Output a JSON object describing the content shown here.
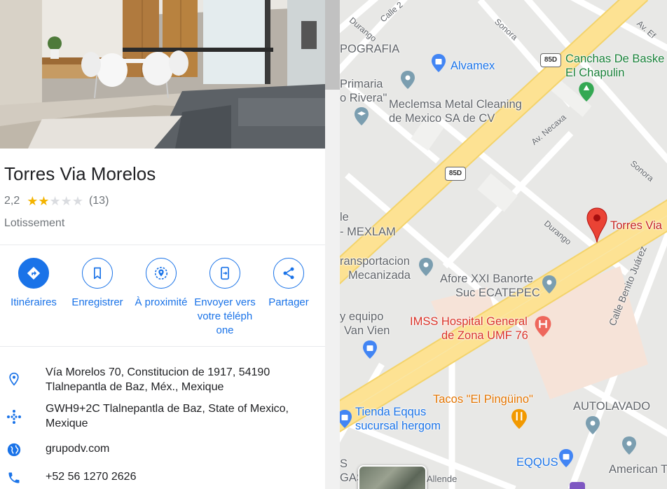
{
  "place": {
    "name": "Torres Via Morelos",
    "rating": "2,2",
    "stars": 2.2,
    "reviews": "(13)",
    "category": "Lotissement"
  },
  "actions": [
    {
      "label": "Itinéraires",
      "icon": "directions-icon"
    },
    {
      "label": "Enregistrer",
      "icon": "bookmark-icon"
    },
    {
      "label": "À proximité",
      "icon": "nearby-icon"
    },
    {
      "label": "Envoyer vers votre téléph one",
      "icon": "send-to-phone-icon"
    },
    {
      "label": "Partager",
      "icon": "share-icon"
    }
  ],
  "info": {
    "address": "Vía Morelos 70, Constitucion de 1917, 54190 Tlalnepantla de Baz, Méx., Mexique",
    "pluscode": "GWH9+2C Tlalnepantla de Baz, State of Mexico, Mexique",
    "website": "grupodv.com",
    "phone": "+52 56 1270 2626"
  },
  "map": {
    "labels": {
      "calle2": "Calle 2",
      "durango1": "Durango",
      "sonora1": "Sonora",
      "avef": "Av. Ef",
      "pografia": "POGRAFIA",
      "alvamex": "Alvamex",
      "canchas1": "Canchas De Baske",
      "canchas2": "El Chapulin",
      "primaria1": "Primaria",
      "primaria2": "o Rivera\"",
      "meclemsa1": "Meclemsa Metal Cleaning",
      "meclemsa2": "de Mexico SA de CV",
      "necaxa": "Av. Necaxa",
      "sonora2": "Sonora",
      "road1": "85D",
      "road2": "85D",
      "mexlam1": "le",
      "mexlam2": "- MEXLAM",
      "durango2": "Durango",
      "torres": "Torres Via",
      "transp1": "ransportacion",
      "transp2": "Mecanizada",
      "afore1": "Afore XXI Banorte",
      "afore2": "Suc ECATEPEC",
      "juarez": "Calle Benito Juárez",
      "equipo1": "y equipo",
      "equipo2": "Van Vien",
      "imss1": "IMSS Hospital General",
      "imss2": "de Zona UMF 76",
      "tacos": "Tacos \"El Pingüino\"",
      "autolavado": "AUTOLAVADO",
      "tienda1": "Tienda Eqqus",
      "tienda2": "sucursal hergom",
      "eqqus": "EQQUS",
      "american": "American T",
      "s1": "S",
      "gas": "GAS",
      "allende": "Allende"
    }
  },
  "colors": {
    "accent": "#1a73e8",
    "star": "#f4b400",
    "highway": "#fde293",
    "pin": "#ea4335"
  }
}
